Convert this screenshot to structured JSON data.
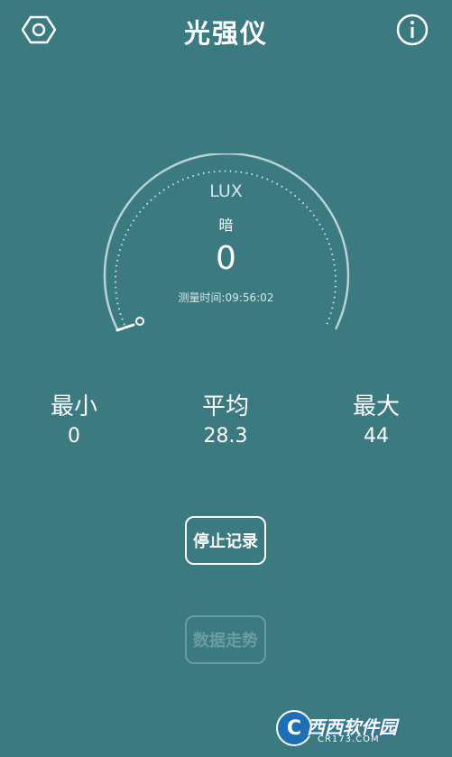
{
  "header": {
    "title": "光强仪",
    "settings_icon": "hexagon-settings-icon",
    "info_icon": "info-circle-icon"
  },
  "gauge": {
    "unit": "LUX",
    "level_text": "暗",
    "reading": "0",
    "time_text": "测量时间:09:56:02",
    "needle_value_fraction": 0
  },
  "stats": {
    "min": {
      "label": "最小",
      "value": "0"
    },
    "avg": {
      "label": "平均",
      "value": "28.3"
    },
    "max": {
      "label": "最大",
      "value": "44"
    }
  },
  "buttons": {
    "stop_record": "停止记录",
    "trend": "数据走势"
  },
  "watermark": {
    "logo_letter": "C",
    "name": "西西软件园",
    "url": "CR173.COM"
  },
  "colors": {
    "background": "#3a7a80",
    "foreground": "#ffffff",
    "disabled": "#6d9ca0"
  }
}
